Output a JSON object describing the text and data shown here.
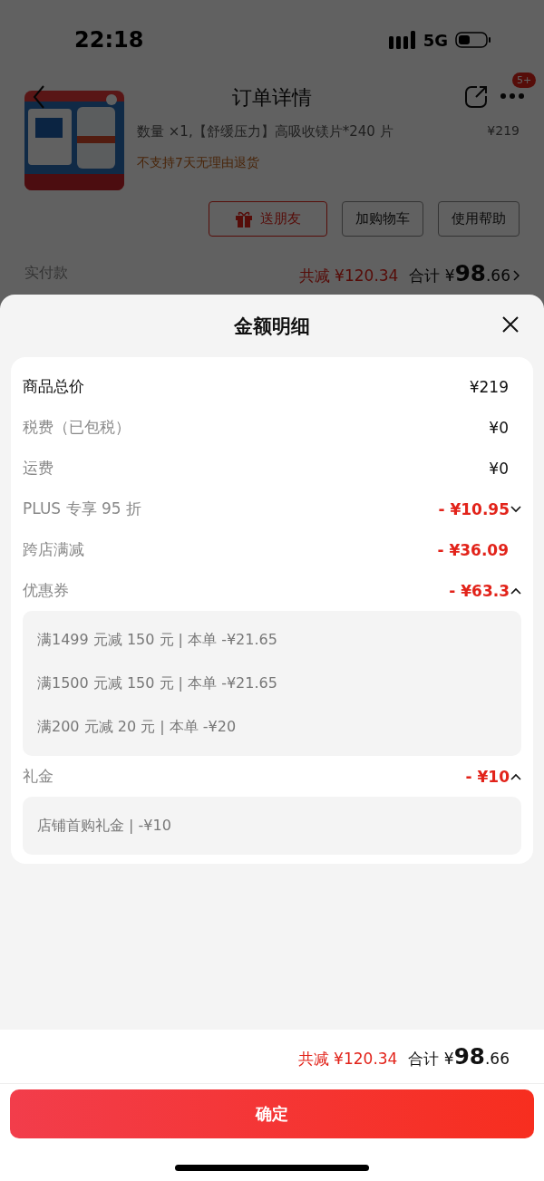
{
  "status_bar": {
    "time": "22:18",
    "network": "5G"
  },
  "nav": {
    "title": "订单详情",
    "badge": "5+"
  },
  "product": {
    "spec": "数量 ×1,【舒缓压力】高吸收镁片*240 片",
    "price": "¥219",
    "notice": "不支持7天无理由退货"
  },
  "actions": [
    {
      "kind": "gift",
      "label": "送朋友"
    },
    {
      "kind": "plain",
      "label": "加购物车"
    },
    {
      "kind": "plain",
      "label": "使用帮助"
    }
  ],
  "payment": {
    "label": "实付款",
    "saving": "共减 ¥120.34",
    "total_label": "合计",
    "currency": "¥",
    "total_int": "98",
    "total_dec": ".66"
  },
  "sheet": {
    "title": "金额明细",
    "rows": [
      {
        "label": "商品总价",
        "value": "¥219",
        "kind": "total"
      },
      {
        "label": "税费（已包税）",
        "value": "¥0",
        "kind": "fee"
      },
      {
        "label": "运费",
        "value": "¥0",
        "kind": "fee"
      },
      {
        "label": "PLUS 专享 95 折",
        "value": "- ¥10.95",
        "kind": "discount",
        "expanded": false
      },
      {
        "label": "跨店满减",
        "value": "- ¥36.09",
        "kind": "discount"
      },
      {
        "label": "优惠券",
        "value": "- ¥63.3",
        "kind": "discount",
        "expanded": true,
        "details": [
          "满1499 元减 150 元 | 本单 -¥21.65",
          "满1500 元减 150 元 | 本单 -¥21.65",
          "满200 元减 20 元 | 本单 -¥20"
        ]
      },
      {
        "label": "礼金",
        "value": "- ¥10",
        "kind": "discount",
        "expanded": true,
        "details": [
          "店铺首购礼金 | -¥10"
        ]
      }
    ]
  },
  "footer": {
    "saving": "共减 ¥120.34",
    "total_label": "合计",
    "currency": "¥",
    "total_int": "98",
    "total_dec": ".66",
    "confirm": "确定"
  }
}
